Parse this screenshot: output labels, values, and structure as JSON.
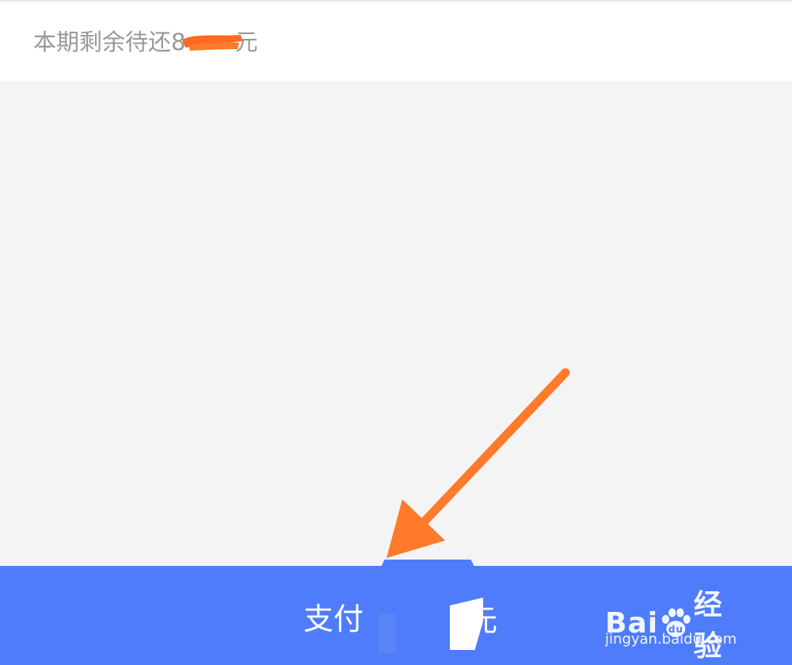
{
  "summary": {
    "remaining_label": "本期剩余待还8",
    "remaining_unit": "元"
  },
  "pay_bar": {
    "label": "支付",
    "unit": "元",
    "background_color": "#4e7cfa"
  },
  "annotation": {
    "arrow_icon": "arrow-down-left-icon",
    "color": "#ff7a2a"
  },
  "watermark": {
    "logo_icon": "baidu-paw-icon",
    "brand_prefix": "Bai",
    "brand_suffix": "经验",
    "site": "jingyan.baidu.com"
  }
}
